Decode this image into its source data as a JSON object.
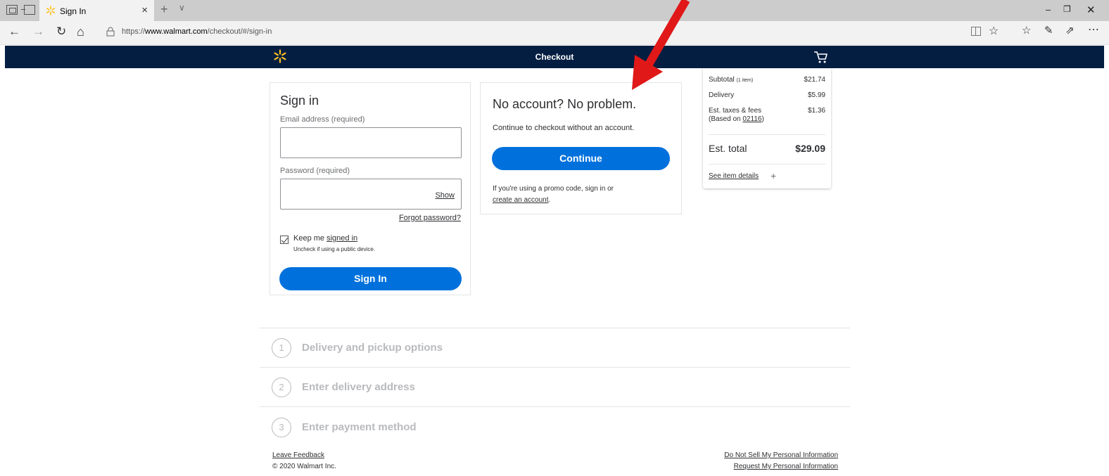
{
  "browser": {
    "tab_title": "Sign In",
    "tab_close": "×",
    "new_tab": "+",
    "tab_menu": "∨",
    "url_prefix": "https://",
    "url_host": "www.walmart.com",
    "url_path": "/checkout/#/sign-in",
    "window_min": "–",
    "window_max": "❐",
    "window_close": "✕",
    "icons": [
      "tab-preview-icon",
      "set-aside-tabs-icon",
      "back-icon",
      "forward-icon",
      "refresh-icon",
      "home-icon",
      "lock-icon",
      "reading-view-icon",
      "favorite-star-icon",
      "favorites-list-icon",
      "notes-pen-icon",
      "share-icon",
      "more-icon"
    ]
  },
  "header": {
    "title": "Checkout",
    "background": "#041e42",
    "spark_color": "#ffc220"
  },
  "signin": {
    "title": "Sign in",
    "email_label": "Email address (required)",
    "email_value": "",
    "password_label": "Password (required)",
    "password_value": "",
    "show_label": "Show",
    "forgot_label": "Forgot password?",
    "keep_prefix": "Keep me ",
    "keep_link": "signed in",
    "keep_checked": true,
    "keep_sub": "Uncheck if using a public device.",
    "button_label": "Sign In",
    "button_color": "#0071dc"
  },
  "guest": {
    "title": "No account? No problem.",
    "subtitle": "Continue to checkout without an account.",
    "button_label": "Continue",
    "promo_line1": "If you're using a promo code, sign in or",
    "promo_link": "create an account",
    "promo_end": "."
  },
  "summary": {
    "subtotal_label": "Subtotal",
    "subtotal_count": "(1 item)",
    "subtotal_value": "$21.74",
    "delivery_label": "Delivery",
    "delivery_value": "$5.99",
    "taxes_label": "Est. taxes & fees",
    "taxes_based_prefix": "(Based on ",
    "taxes_zip": "02116",
    "taxes_based_suffix": ")",
    "taxes_value": "$1.36",
    "total_label": "Est. total",
    "total_value": "$29.09",
    "details_label": "See item details",
    "details_icon": "+"
  },
  "steps": [
    {
      "num": "1",
      "label": "Delivery and pickup options"
    },
    {
      "num": "2",
      "label": "Enter delivery address"
    },
    {
      "num": "3",
      "label": "Enter payment method"
    }
  ],
  "footer": {
    "feedback": "Leave Feedback",
    "copyright": "© 2020 Walmart Inc.",
    "do_not_sell": "Do Not Sell My Personal Information",
    "request_info": "Request My Personal Information"
  },
  "annotation": {
    "arrow_color": "#e01818"
  }
}
